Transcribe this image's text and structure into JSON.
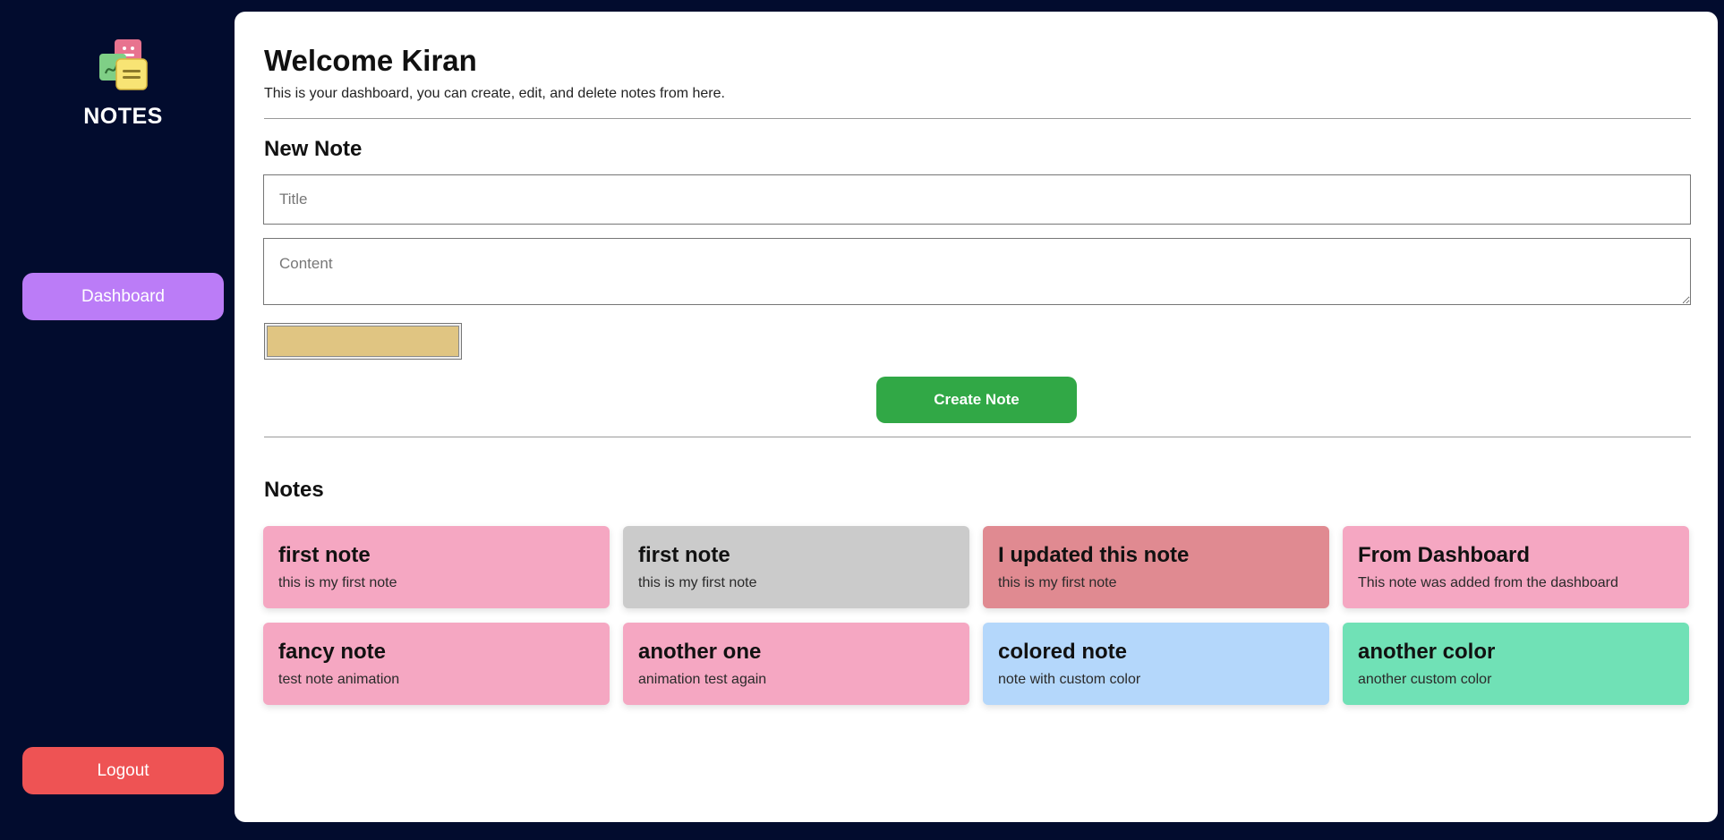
{
  "sidebar": {
    "logo_icon": "sticky-notes-icon",
    "brand": "NOTES",
    "dashboard_label": "Dashboard",
    "logout_label": "Logout"
  },
  "header": {
    "welcome": "Welcome Kiran",
    "subtitle": "This is your dashboard, you can create, edit, and delete notes from here."
  },
  "new_note": {
    "heading": "New Note",
    "title_placeholder": "Title",
    "title_value": "",
    "content_placeholder": "Content",
    "content_value": "",
    "selected_color": "#e0c582",
    "create_label": "Create Note"
  },
  "notes_section": {
    "heading": "Notes",
    "notes": [
      {
        "title": "first note",
        "content": "this is my first note",
        "color": "#f5a7c2"
      },
      {
        "title": "first note",
        "content": "this is my first note",
        "color": "#cbcbcb"
      },
      {
        "title": "I updated this note",
        "content": "this is my first note",
        "color": "#e08a91"
      },
      {
        "title": "From Dashboard",
        "content": "This note was added from the dashboard",
        "color": "#f5a7c2"
      },
      {
        "title": "fancy note",
        "content": "test note animation",
        "color": "#f5a7c2"
      },
      {
        "title": "another one",
        "content": "animation test again",
        "color": "#f5a7c2"
      },
      {
        "title": "colored note",
        "content": "note with custom color",
        "color": "#b4d7fb"
      },
      {
        "title": "another color",
        "content": "another custom color",
        "color": "#70e1b6"
      }
    ]
  },
  "colors": {
    "background": "#020c2e",
    "panel": "#ffffff",
    "dashboard_button": "#bb7cf7",
    "logout_button": "#ee5354",
    "create_button": "#31a846"
  }
}
